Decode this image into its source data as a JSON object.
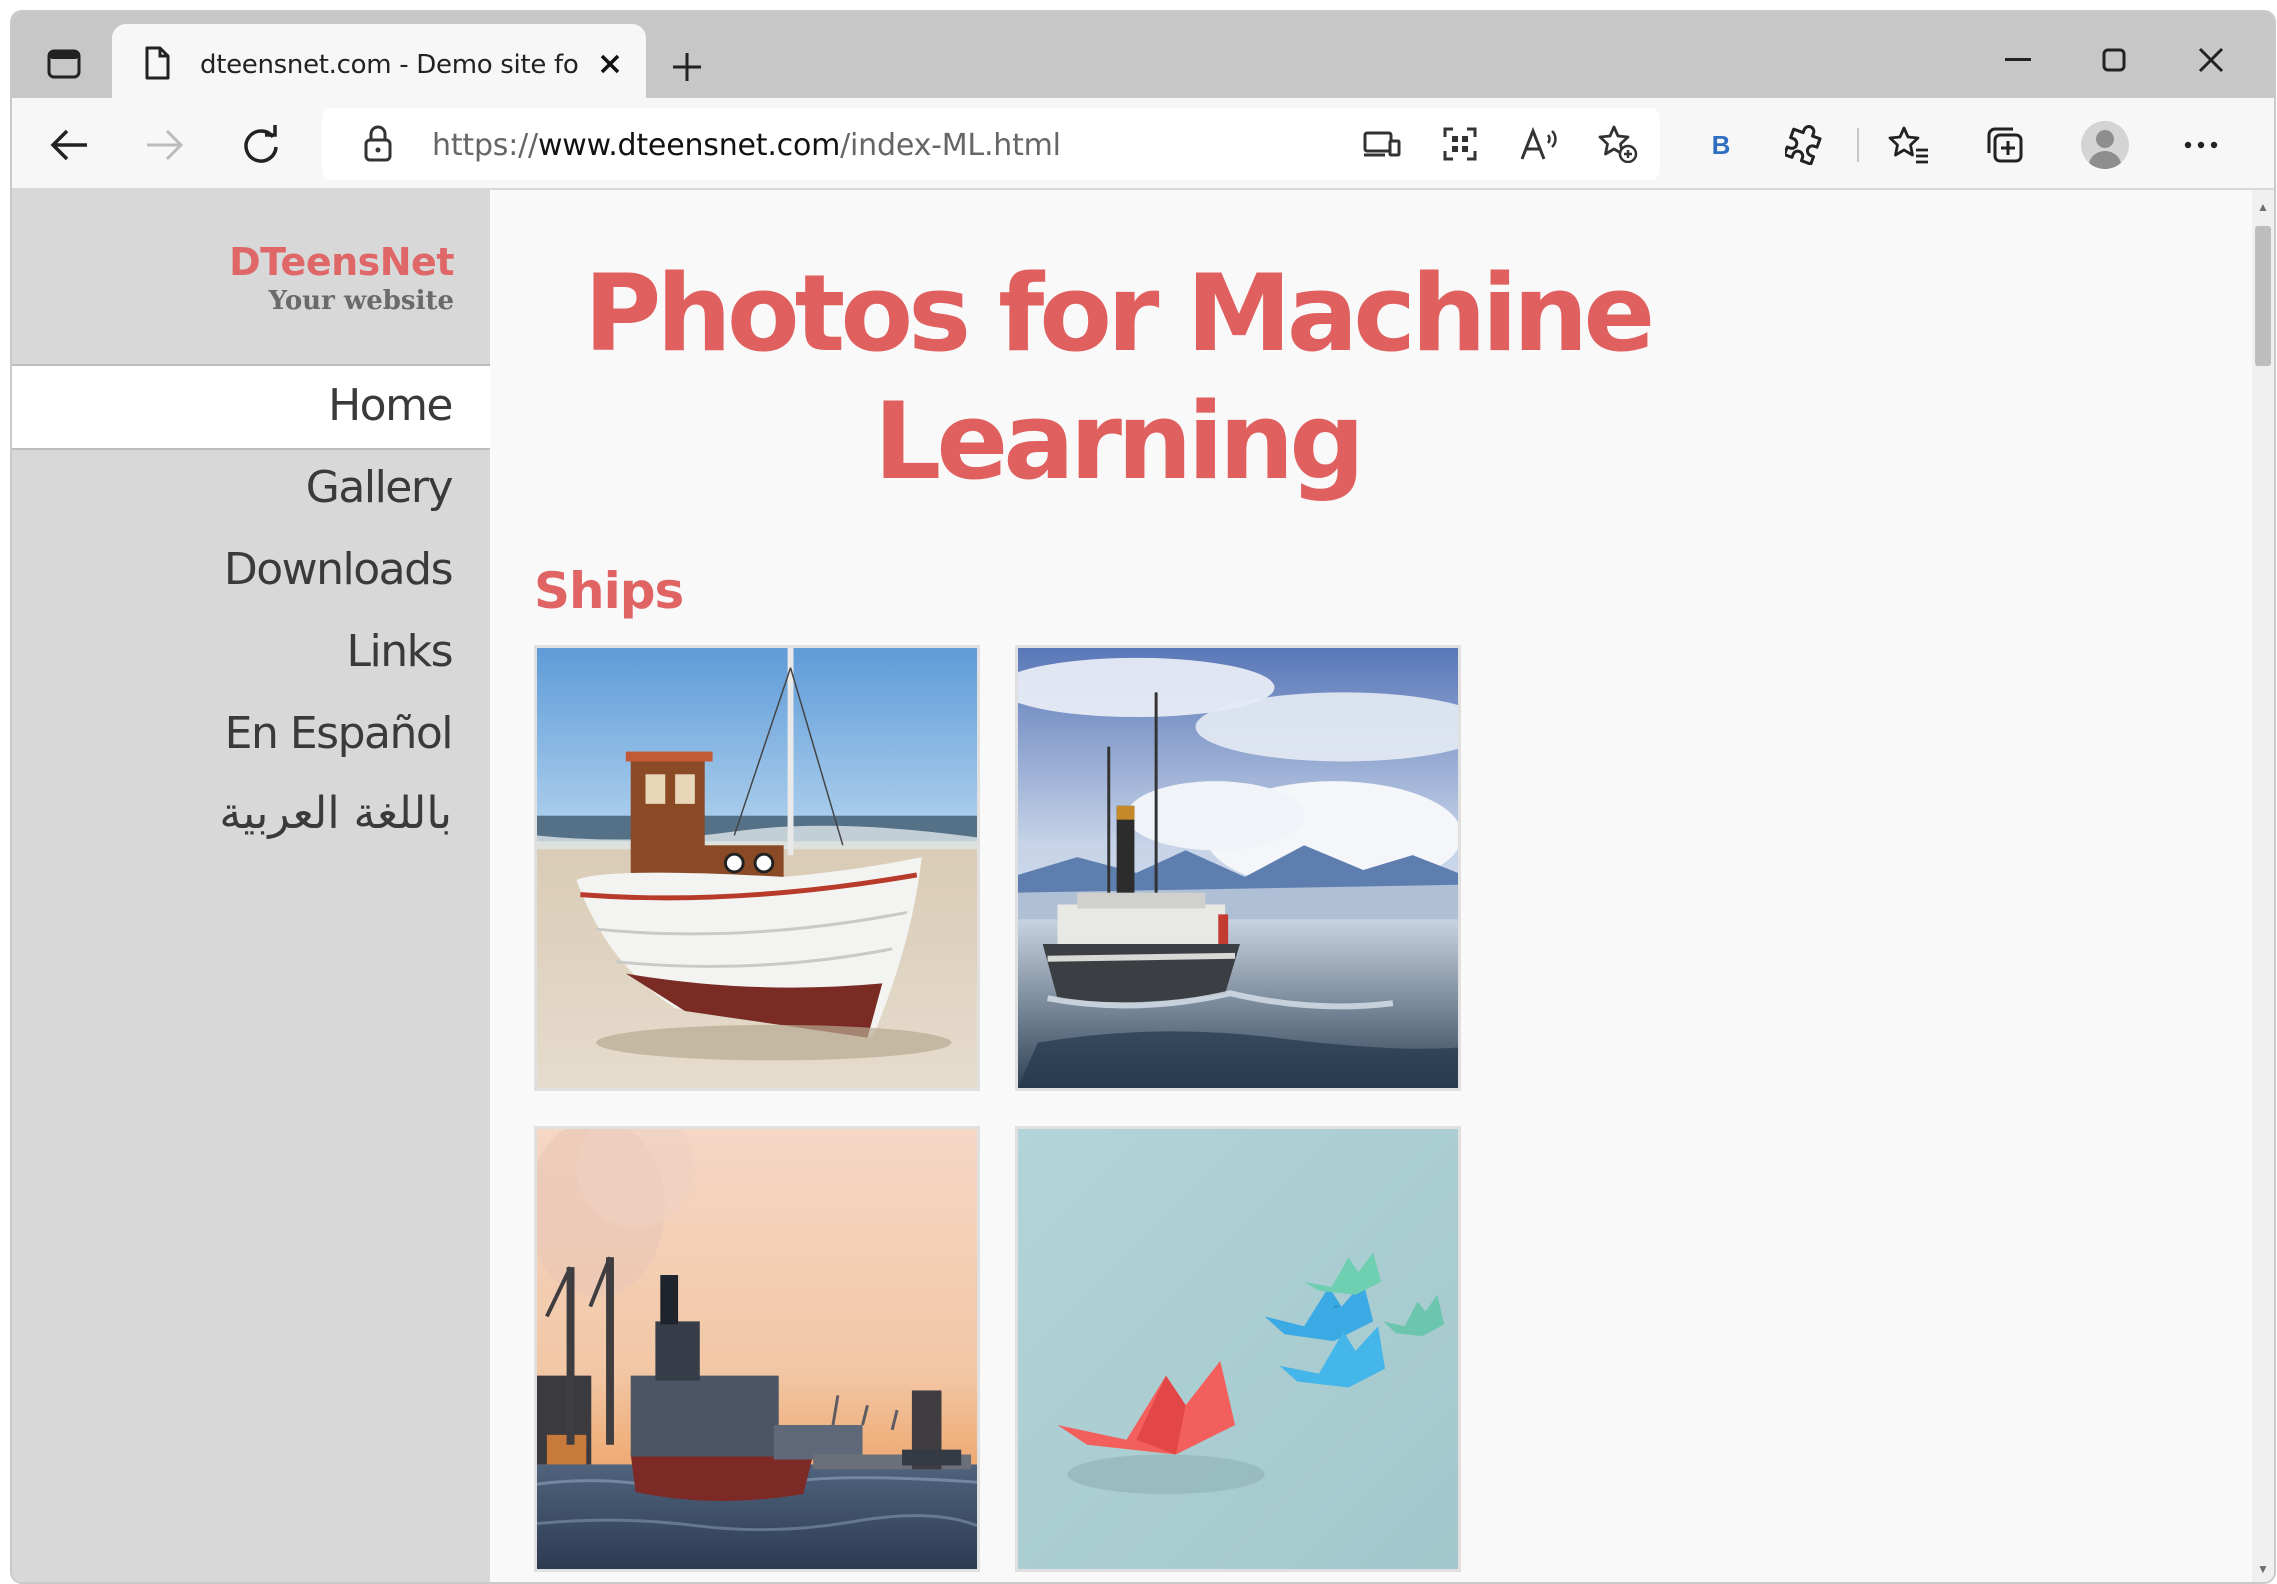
{
  "browser": {
    "tab_title": "dteensnet.com - Demo site for D",
    "url_prefix": "https://",
    "url_host": "www.dteensnet.com",
    "url_path": "/index-ML.html",
    "bing_label": "B"
  },
  "sidebar": {
    "brand_name": "DTeensNet",
    "brand_tagline": "Your website",
    "nav": [
      {
        "label": "Home",
        "active": true
      },
      {
        "label": "Gallery"
      },
      {
        "label": "Downloads"
      },
      {
        "label": "Links"
      },
      {
        "label": "En Español"
      },
      {
        "label": "باللغة العربية"
      }
    ]
  },
  "main": {
    "title_line1": "Photos for Machine",
    "title_line2": "Learning",
    "section": "Ships",
    "photos": [
      "fishing-boat-on-beach",
      "steamship-with-mountains",
      "cargo-ship-at-sunset",
      "paper-boats"
    ]
  },
  "colors": {
    "accent": "#e06060",
    "sidebar_bg": "#d8d8d8",
    "tabbar_bg": "#c6c7c6"
  }
}
